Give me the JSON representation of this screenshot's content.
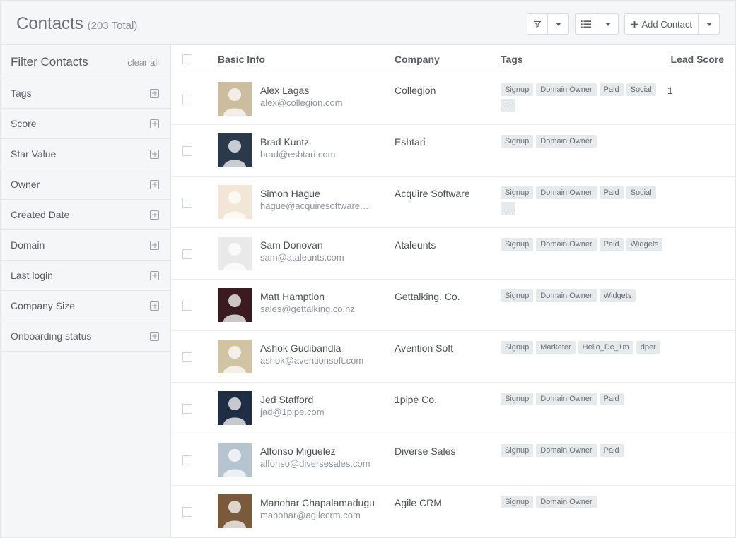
{
  "header": {
    "title": "Contacts",
    "subtitle": "(203 Total)",
    "add_label": "Add Contact"
  },
  "sidebar": {
    "title": "Filter Contacts",
    "clear_label": "clear all",
    "filters": [
      {
        "label": "Tags"
      },
      {
        "label": "Score"
      },
      {
        "label": "Star Value"
      },
      {
        "label": "Owner"
      },
      {
        "label": "Created Date"
      },
      {
        "label": "Domain"
      },
      {
        "label": "Last login"
      },
      {
        "label": "Company Size"
      },
      {
        "label": "Onboarding status"
      }
    ]
  },
  "table": {
    "columns": {
      "basic": "Basic Info",
      "company": "Company",
      "tags": "Tags",
      "score": "Lead Score"
    },
    "rows": [
      {
        "name": "Alex Lagas",
        "email": "alex@collegion.com",
        "company": "Collegion",
        "tags": [
          "Signup",
          "Domain Owner",
          "Paid",
          "Social",
          "..."
        ],
        "score": "1",
        "avatar_bg": "#cbbd9e"
      },
      {
        "name": "Brad Kuntz",
        "email": "brad@eshtari.com",
        "company": "Eshtari",
        "tags": [
          "Signup",
          "Domain Owner"
        ],
        "score": "",
        "avatar_bg": "#2b3a4a"
      },
      {
        "name": "Simon Hague",
        "email": "hague@acquiresoftware.…",
        "company": "Acquire Software",
        "tags": [
          "Signup",
          "Domain Owner",
          "Paid",
          "Social",
          "..."
        ],
        "score": "",
        "avatar_bg": "#f2e6d7"
      },
      {
        "name": "Sam Donovan",
        "email": "sam@ataleunts.com",
        "company": "Ataleunts",
        "tags": [
          "Signup",
          "Domain Owner",
          "Paid",
          "Widgets"
        ],
        "score": "",
        "avatar_bg": "#e9e9e9"
      },
      {
        "name": "Matt Hamption",
        "email": "sales@gettalking.co.nz",
        "company": "Gettalking. Co.",
        "tags": [
          "Signup",
          "Domain Owner",
          "Widgets"
        ],
        "score": "",
        "avatar_bg": "#3a1c20"
      },
      {
        "name": "Ashok Gudibandla",
        "email": "ashok@aventionsoft.com",
        "company": "Avention Soft",
        "tags": [
          "Signup",
          "Marketer",
          "Hello_Dc_1m",
          "dper"
        ],
        "score": "",
        "avatar_bg": "#d0c4a5"
      },
      {
        "name": "Jed Stafford",
        "email": "jad@1pipe.com",
        "company": "1pipe Co.",
        "tags": [
          "Signup",
          "Domain Owner",
          "Paid"
        ],
        "score": "",
        "avatar_bg": "#1f2e44"
      },
      {
        "name": "Alfonso Miguelez",
        "email": "alfonso@diversesales.com",
        "company": "Diverse Sales",
        "tags": [
          "Signup",
          "Domain Owner",
          "Paid"
        ],
        "score": "",
        "avatar_bg": "#b6c4d0"
      },
      {
        "name": "Manohar Chapalamadugu",
        "email": "manohar@agilecrm.com",
        "company": "Agile CRM",
        "tags": [
          "Signup",
          "Domain Owner"
        ],
        "score": "",
        "avatar_bg": "#7a5a3a"
      }
    ]
  }
}
